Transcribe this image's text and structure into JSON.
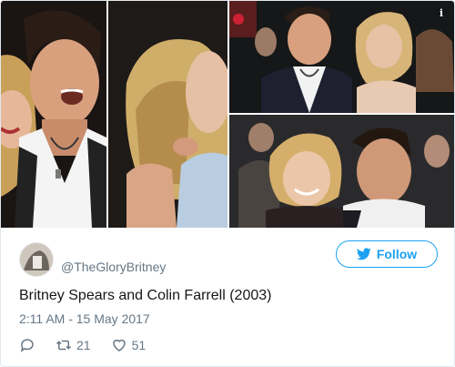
{
  "tweet": {
    "handle": "@TheGloryBritney",
    "text": "Britney Spears and Colin Farrell (2003)",
    "timestamp": "2:11 AM - 15 May 2017",
    "retweets": "21",
    "likes": "51"
  },
  "follow_button": {
    "label": "Follow"
  },
  "info_icon": {
    "glyph": "i"
  },
  "colors": {
    "accent": "#1da1f2",
    "secondary_text": "#657786",
    "primary_text": "#14171a"
  },
  "icons": [
    "info-icon",
    "bird-icon",
    "reply-icon",
    "retweet-icon",
    "heart-icon"
  ]
}
